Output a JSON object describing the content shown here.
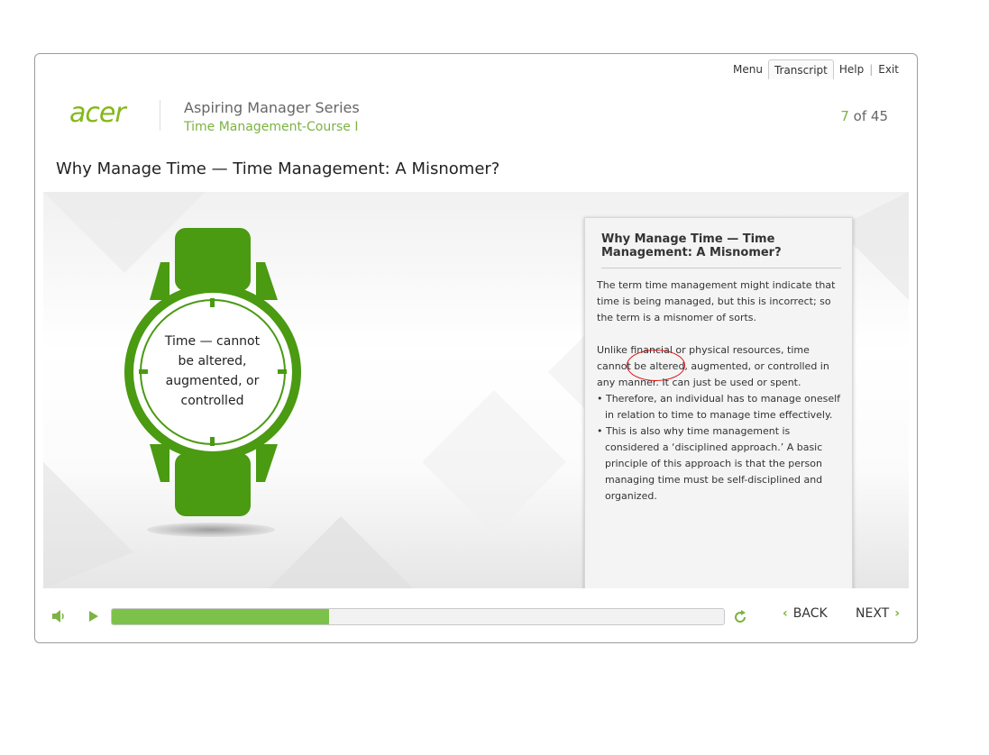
{
  "nav": {
    "menu": "Menu",
    "transcript": "Transcript",
    "help": "Help",
    "exit": "Exit",
    "separator": "|"
  },
  "header": {
    "logo_text": "acer",
    "series": "Aspiring Manager Series",
    "course": "Time Management-Course I",
    "page_current": "7",
    "page_of": " of 45"
  },
  "slide": {
    "title": "Why Manage Time — Time Management: A Misnomer?",
    "watch_text": "Time — cannot be altered, augmented, or controlled"
  },
  "transcript": {
    "title": "Why Manage Time — Time Management: A Misnomer?",
    "para1": "The term time management might indicate that time is being managed, but this is incorrect; so the term is a misnomer of sorts.",
    "para2": "Unlike financial or physical resources, time cannot be altered, augmented, or controlled in any manner. It can just be used or spent.",
    "bullets": [
      "• Therefore, an individual has to manage oneself in relation to time to manage time effectively.",
      "• This is also why time management is considered a ‘disciplined approach.’ A basic principle of this approach is that the person managing time must be self-disciplined and organized."
    ]
  },
  "controls": {
    "back_label": "BACK",
    "next_label": "NEXT",
    "progress_fraction": 0.355
  },
  "colors": {
    "accent": "#7cb342",
    "watch": "#4a9a12",
    "annotation": "#dd1111"
  },
  "icons": [
    "volume-icon",
    "play-icon",
    "replay-icon",
    "chevron-left-icon",
    "chevron-right-icon"
  ]
}
